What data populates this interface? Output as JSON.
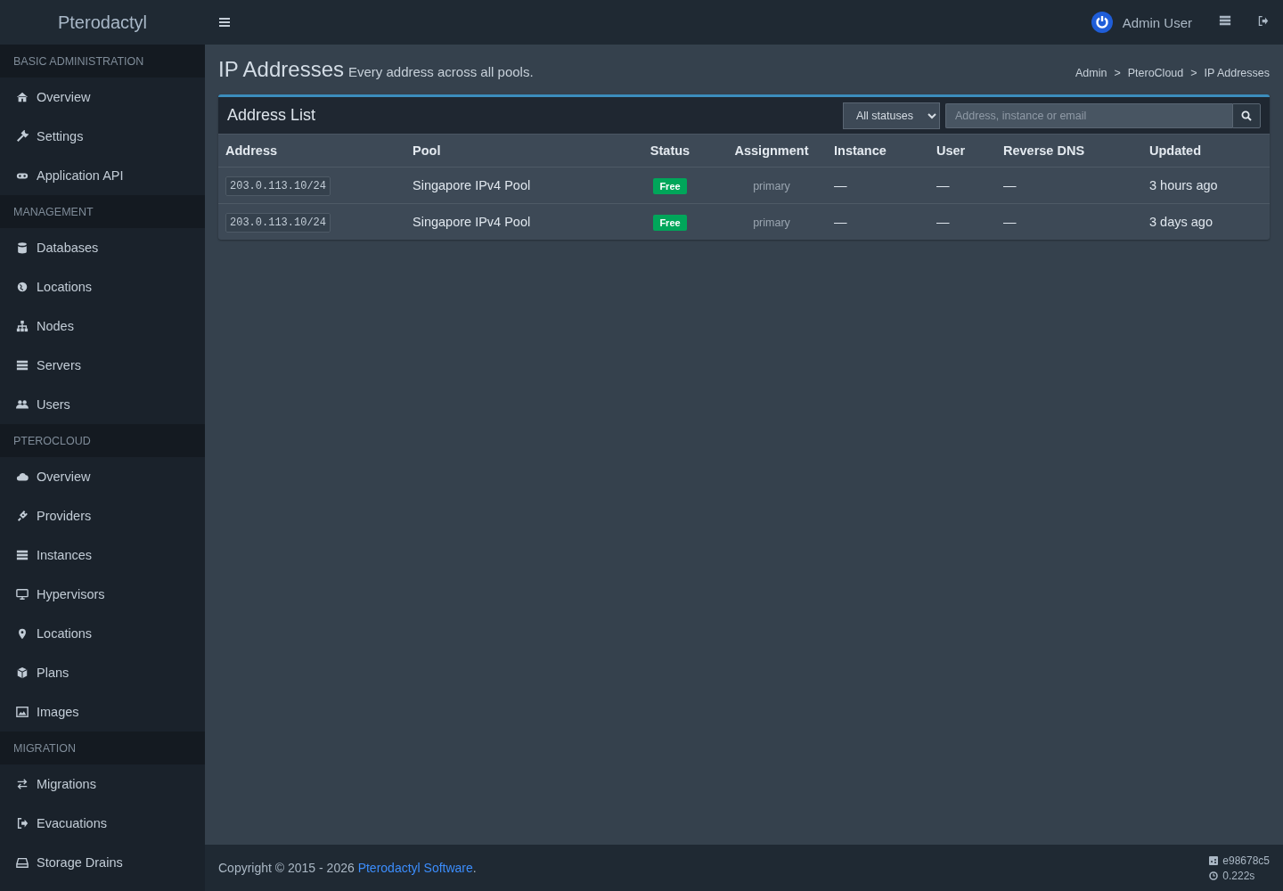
{
  "brand": "Pterodactyl",
  "sidebar": {
    "sections": [
      {
        "title": "BASIC ADMINISTRATION",
        "items": [
          {
            "label": "Overview"
          },
          {
            "label": "Settings"
          },
          {
            "label": "Application API"
          }
        ]
      },
      {
        "title": "MANAGEMENT",
        "items": [
          {
            "label": "Databases"
          },
          {
            "label": "Locations"
          },
          {
            "label": "Nodes"
          },
          {
            "label": "Servers"
          },
          {
            "label": "Users"
          }
        ]
      },
      {
        "title": "PTEROCLOUD",
        "items": [
          {
            "label": "Overview"
          },
          {
            "label": "Providers"
          },
          {
            "label": "Instances"
          },
          {
            "label": "Hypervisors"
          },
          {
            "label": "Locations"
          },
          {
            "label": "Plans"
          },
          {
            "label": "Images"
          }
        ]
      },
      {
        "title": "MIGRATION",
        "items": [
          {
            "label": "Migrations"
          },
          {
            "label": "Evacuations"
          },
          {
            "label": "Storage Drains"
          }
        ]
      }
    ]
  },
  "topbar": {
    "user": "Admin User"
  },
  "page": {
    "title": "IP Addresses",
    "subtitle": "Every address across all pools.",
    "breadcrumb": [
      "Admin",
      "PteroCloud",
      "IP Addresses"
    ],
    "separator": ">"
  },
  "box": {
    "title": "Address List",
    "status_filter": "All statuses",
    "search": {
      "placeholder": "Address, instance or email"
    },
    "table": {
      "columns": [
        "Address",
        "Pool",
        "Status",
        "Assignment",
        "Instance",
        "User",
        "Reverse DNS",
        "Updated"
      ],
      "rows": [
        {
          "address": "203.0.113.10/24",
          "pool": "Singapore IPv4 Pool",
          "status": "Free",
          "assignment": "primary",
          "instance": "—",
          "user": "—",
          "reverse_dns": "—",
          "updated": "3 hours ago"
        },
        {
          "address": "203.0.113.10/24",
          "pool": "Singapore IPv4 Pool",
          "status": "Free",
          "assignment": "primary",
          "instance": "—",
          "user": "—",
          "reverse_dns": "—",
          "updated": "3 days ago"
        }
      ]
    }
  },
  "footer": {
    "copyright": "Copyright © 2015 - 2026",
    "link": "Pterodactyl Software",
    "end": ".",
    "commit": "e98678c5",
    "time": "0.222s"
  }
}
